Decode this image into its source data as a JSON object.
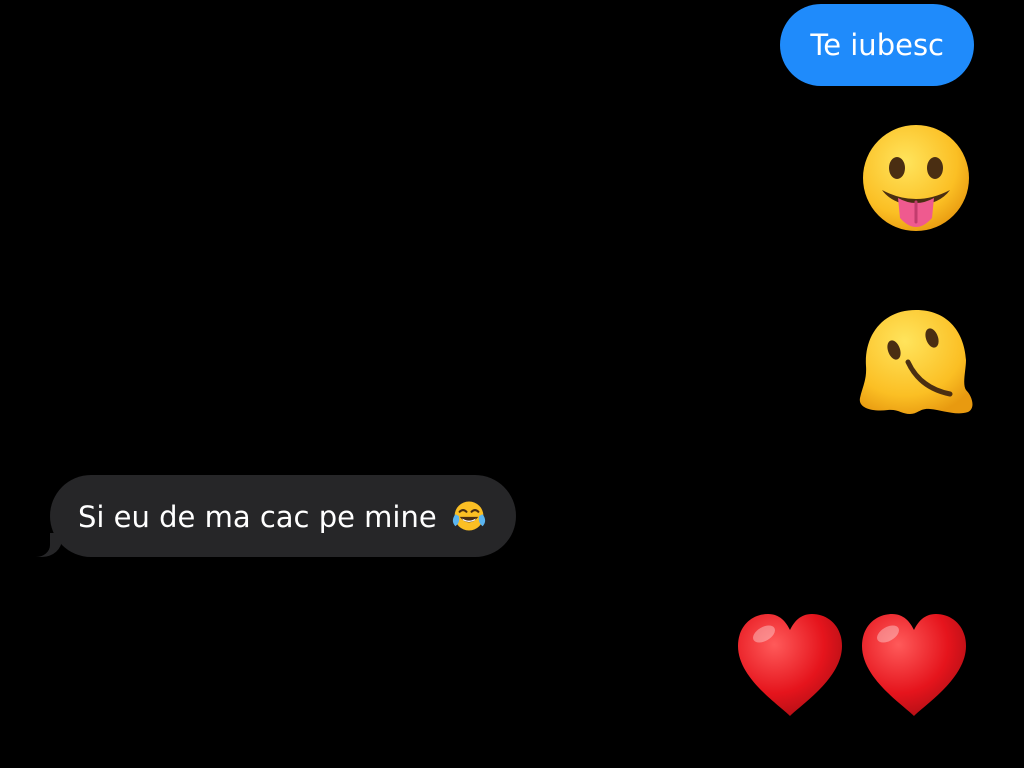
{
  "conversation": {
    "messages": [
      {
        "sender": "me",
        "kind": "text",
        "text": "Te iubesc"
      },
      {
        "sender": "me",
        "kind": "emoji",
        "emoji": "face-with-tongue-icon"
      },
      {
        "sender": "me",
        "kind": "emoji",
        "emoji": "melting-face-icon"
      },
      {
        "sender": "them",
        "kind": "text",
        "text": "Si eu de ma cac pe mine",
        "emoji": "tears-of-joy-icon"
      },
      {
        "sender": "me",
        "kind": "emoji",
        "emoji": [
          "red-heart-icon",
          "red-heart-icon"
        ]
      }
    ]
  },
  "colors": {
    "background": "#000000",
    "sent_bubble": "#1f8bfb",
    "received_bubble": "#262628",
    "text": "#ffffff"
  }
}
